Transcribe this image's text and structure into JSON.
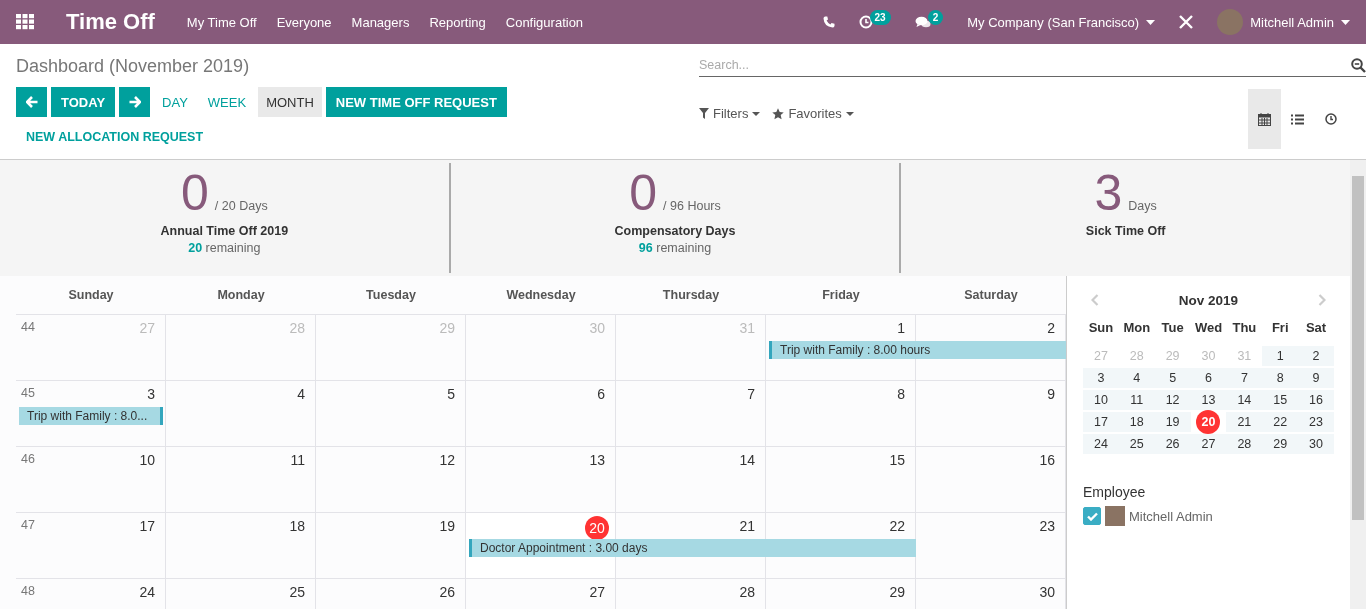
{
  "app": {
    "title": "Time Off"
  },
  "menu": [
    {
      "label": "My Time Off"
    },
    {
      "label": "Everyone"
    },
    {
      "label": "Managers"
    },
    {
      "label": "Reporting"
    },
    {
      "label": "Configuration"
    }
  ],
  "systray": {
    "activity_count": "23",
    "message_count": "2",
    "company": "My Company (San Francisco)",
    "user": "Mitchell Admin"
  },
  "breadcrumb": "Dashboard (November 2019)",
  "nav_buttons": {
    "today": "TODAY"
  },
  "scales": [
    {
      "label": "DAY",
      "selected": false
    },
    {
      "label": "WEEK",
      "selected": false
    },
    {
      "label": "MONTH",
      "selected": true
    }
  ],
  "actions": [
    {
      "label": "NEW TIME OFF REQUEST",
      "kind": "primary"
    },
    {
      "label": "NEW ALLOCATION REQUEST",
      "kind": "link"
    }
  ],
  "search": {
    "placeholder": "Search..."
  },
  "filters": [
    {
      "label": "Filters",
      "kind": "filter"
    },
    {
      "label": "Favorites",
      "kind": "star"
    }
  ],
  "views": [
    {
      "kind": "calendar",
      "selected": true
    },
    {
      "kind": "list",
      "selected": false
    },
    {
      "kind": "activity",
      "selected": false
    }
  ],
  "summary": [
    {
      "value": "0",
      "unit": "/ 20 Days",
      "title": "Annual Time Off 2019",
      "remaining_count": "20",
      "remaining_label": "remaining"
    },
    {
      "value": "0",
      "unit": "/ 96 Hours",
      "title": "Compensatory Days",
      "remaining_count": "96",
      "remaining_label": "remaining"
    },
    {
      "value": "3",
      "unit": "Days",
      "title": "Sick Time Off"
    }
  ],
  "calendar": {
    "weekdays": [
      "Sunday",
      "Monday",
      "Tuesday",
      "Wednesday",
      "Thursday",
      "Friday",
      "Saturday"
    ],
    "weeks": [
      {
        "number": "44",
        "days": [
          {
            "day": "27",
            "other_month": true
          },
          {
            "day": "28",
            "other_month": true
          },
          {
            "day": "29",
            "other_month": true
          },
          {
            "day": "30",
            "other_month": true
          },
          {
            "day": "31",
            "other_month": true
          },
          {
            "day": "1",
            "event": {
              "label": "Trip with Family : 8.00 hours",
              "kind": "start"
            }
          },
          {
            "day": "2",
            "covered": true
          }
        ]
      },
      {
        "number": "45",
        "days": [
          {
            "day": "3",
            "event": {
              "label": "Trip with Family : 8.0...",
              "kind": "end"
            }
          },
          {
            "day": "4"
          },
          {
            "day": "5"
          },
          {
            "day": "6"
          },
          {
            "day": "7"
          },
          {
            "day": "8"
          },
          {
            "day": "9"
          }
        ]
      },
      {
        "number": "46",
        "days": [
          {
            "day": "10"
          },
          {
            "day": "11"
          },
          {
            "day": "12"
          },
          {
            "day": "13"
          },
          {
            "day": "14"
          },
          {
            "day": "15"
          },
          {
            "day": "16"
          }
        ]
      },
      {
        "number": "47",
        "days": [
          {
            "day": "17"
          },
          {
            "day": "18"
          },
          {
            "day": "19"
          },
          {
            "day": "20",
            "today": true,
            "event": {
              "label": "Doctor Appointment : 3.00 days",
              "kind": "start"
            }
          },
          {
            "day": "21",
            "covered": true
          },
          {
            "day": "22",
            "covered": true
          },
          {
            "day": "23"
          }
        ]
      },
      {
        "number": "48",
        "days": [
          {
            "day": "24"
          },
          {
            "day": "25"
          },
          {
            "day": "26"
          },
          {
            "day": "27"
          },
          {
            "day": "28"
          },
          {
            "day": "29"
          },
          {
            "day": "30"
          }
        ]
      }
    ]
  },
  "mini_calendar": {
    "title": "Nov 2019",
    "weekdays": [
      "Sun",
      "Mon",
      "Tue",
      "Wed",
      "Thu",
      "Fri",
      "Sat"
    ],
    "weeks": [
      [
        {
          "day": "27",
          "other_month": true
        },
        {
          "day": "28",
          "other_month": true
        },
        {
          "day": "29",
          "other_month": true
        },
        {
          "day": "30",
          "other_month": true
        },
        {
          "day": "31",
          "other_month": true
        },
        {
          "day": "1"
        },
        {
          "day": "2"
        }
      ],
      [
        {
          "day": "3"
        },
        {
          "day": "4"
        },
        {
          "day": "5"
        },
        {
          "day": "6"
        },
        {
          "day": "7"
        },
        {
          "day": "8"
        },
        {
          "day": "9"
        }
      ],
      [
        {
          "day": "10"
        },
        {
          "day": "11"
        },
        {
          "day": "12"
        },
        {
          "day": "13"
        },
        {
          "day": "14"
        },
        {
          "day": "15"
        },
        {
          "day": "16"
        }
      ],
      [
        {
          "day": "17"
        },
        {
          "day": "18"
        },
        {
          "day": "19"
        },
        {
          "day": "20",
          "today": true
        },
        {
          "day": "21"
        },
        {
          "day": "22"
        },
        {
          "day": "23"
        }
      ],
      [
        {
          "day": "24"
        },
        {
          "day": "25"
        },
        {
          "day": "26"
        },
        {
          "day": "27"
        },
        {
          "day": "28"
        },
        {
          "day": "29"
        },
        {
          "day": "30"
        }
      ]
    ]
  },
  "filter_panel": {
    "title": "Employee",
    "items": [
      {
        "label": "Mitchell Admin",
        "checked": true
      }
    ]
  }
}
